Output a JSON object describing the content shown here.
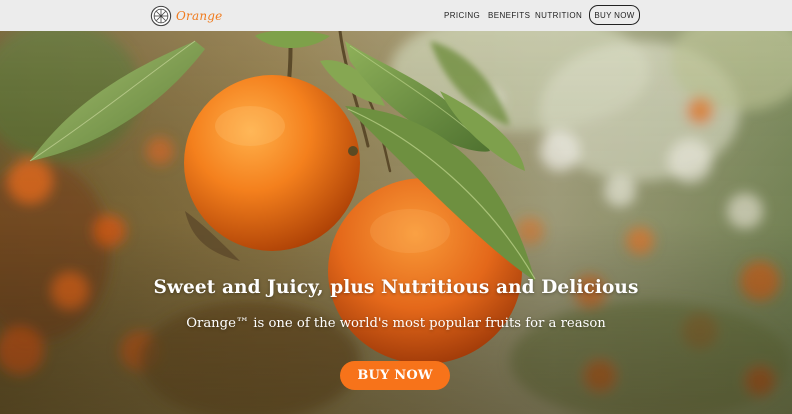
{
  "nav": {
    "brand": "Orange",
    "logo_icon": "orange-slice-icon",
    "links": [
      "PRICING",
      "BENEFITS",
      "NUTRITION"
    ],
    "buy_label": "BUY NOW"
  },
  "hero": {
    "title": "Sweet and Juicy, plus Nutritious and Delicious",
    "subtitle": "Orange™ is one of the world's most popular fruits for a reason",
    "cta_label": "BUY NOW",
    "image_subject": "two oranges hanging on a branch with green leaves, blurred orange grove background"
  },
  "colors": {
    "accent": "#f7731a",
    "brand_text": "#f07b1e",
    "navbar_bg": "#ececec",
    "nav_text": "#222222"
  }
}
